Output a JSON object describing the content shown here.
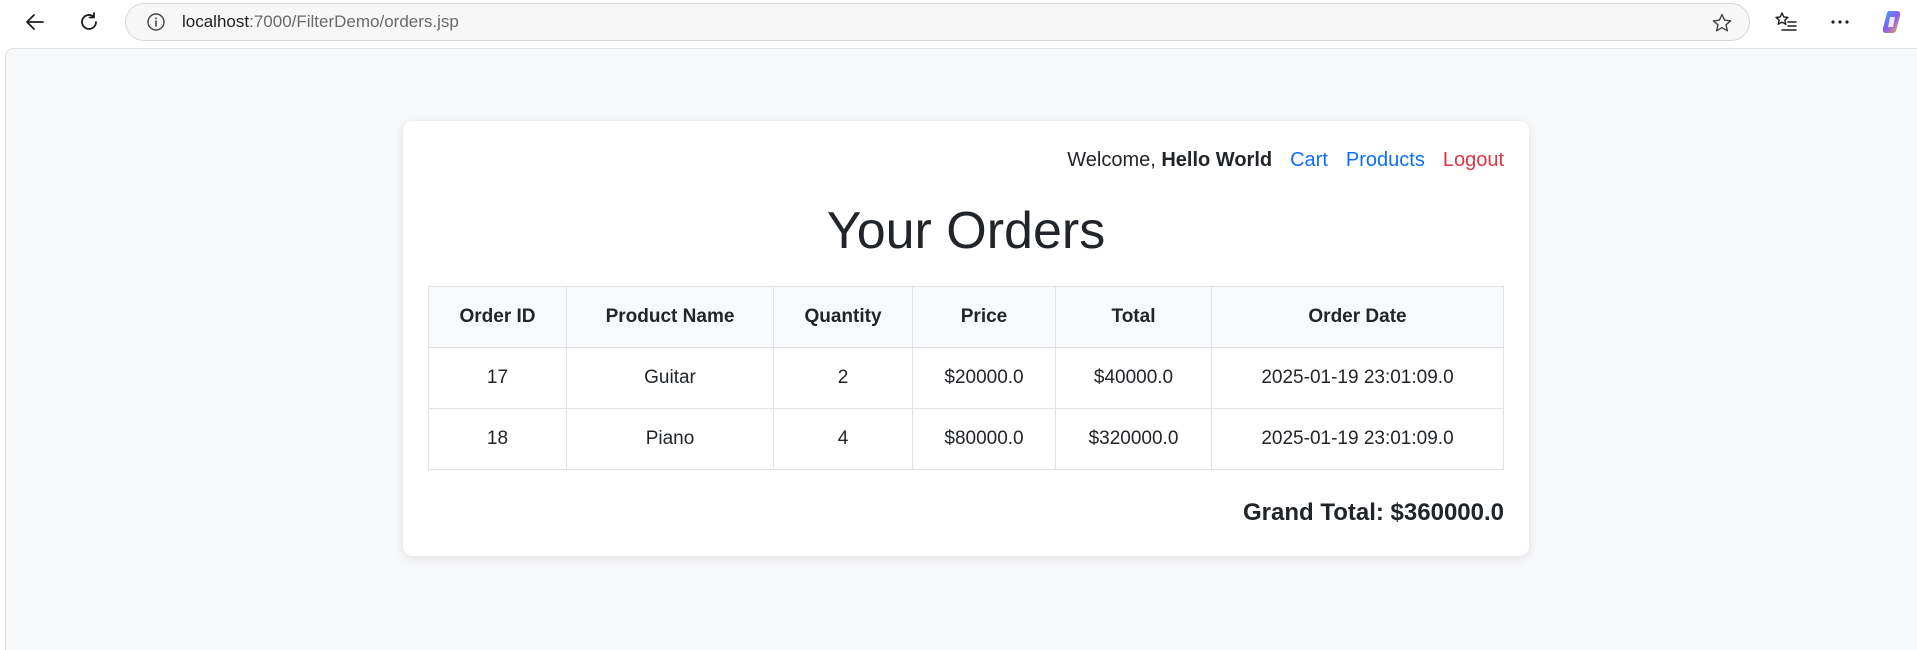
{
  "browser": {
    "url_host": "localhost",
    "url_path": ":7000/FilterDemo/orders.jsp"
  },
  "header": {
    "welcome_prefix": "Welcome, ",
    "username": "Hello World",
    "links": {
      "cart": "Cart",
      "products": "Products",
      "logout": "Logout"
    }
  },
  "page": {
    "title": "Your Orders"
  },
  "table": {
    "headers": [
      "Order ID",
      "Product Name",
      "Quantity",
      "Price",
      "Total",
      "Order Date"
    ],
    "rows": [
      [
        "17",
        "Guitar",
        "2",
        "$20000.0",
        "$40000.0",
        "2025-01-19 23:01:09.0"
      ],
      [
        "18",
        "Piano",
        "4",
        "$80000.0",
        "$320000.0",
        "2025-01-19 23:01:09.0"
      ]
    ]
  },
  "grand_total": "Grand Total: $360000.0",
  "colors": {
    "link": "#0d6efd",
    "logout": "#dc3545",
    "background": "#f7f8fa"
  }
}
